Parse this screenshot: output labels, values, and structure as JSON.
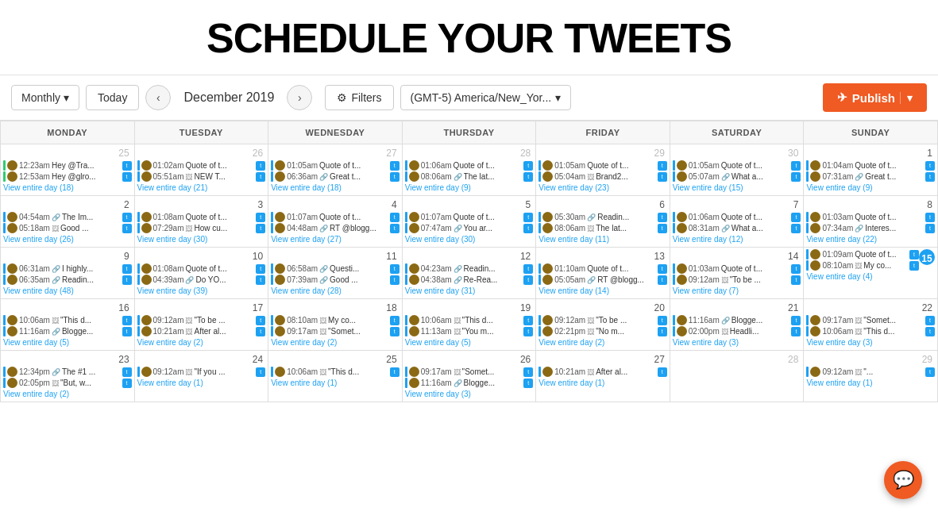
{
  "title": "SCHEDULE YOUR TWEETS",
  "toolbar": {
    "monthly_label": "Monthly",
    "today_label": "Today",
    "prev_label": "‹",
    "next_label": "›",
    "date_label": "December 2019",
    "filters_label": "Filters",
    "timezone_label": "(GMT-5) America/New_Yor...",
    "publish_label": "Publish"
  },
  "calendar": {
    "headers": [
      "MONDAY",
      "TUESDAY",
      "WEDNESDAY",
      "THURSDAY",
      "FRIDAY",
      "SATURDAY",
      "SUNDAY"
    ],
    "weeks": [
      {
        "days": [
          {
            "num": "25",
            "other": true,
            "tweets": [
              {
                "time": "12:23am",
                "icon": "",
                "text": "Hey @Tra...",
                "bar": "green"
              },
              {
                "time": "12:53am",
                "icon": "",
                "text": "Hey @glro...",
                "bar": "green"
              }
            ],
            "view": "View entire day (18)"
          },
          {
            "num": "26",
            "other": true,
            "tweets": [
              {
                "time": "01:02am",
                "icon": "",
                "text": "Quote of t...",
                "bar": "blue"
              },
              {
                "time": "05:51am",
                "icon": "🖼",
                "text": "NEW T...",
                "bar": "blue"
              }
            ],
            "view": "View entire day (21)"
          },
          {
            "num": "27",
            "other": true,
            "tweets": [
              {
                "time": "01:05am",
                "icon": "",
                "text": "Quote of t...",
                "bar": "blue"
              },
              {
                "time": "06:36am",
                "icon": "🔗",
                "text": "Great t...",
                "bar": "blue"
              }
            ],
            "view": "View entire day (18)"
          },
          {
            "num": "28",
            "other": true,
            "tweets": [
              {
                "time": "01:06am",
                "icon": "",
                "text": "Quote of t...",
                "bar": "blue"
              },
              {
                "time": "08:06am",
                "icon": "🔗",
                "text": "The lat...",
                "bar": "blue"
              }
            ],
            "view": "View entire day (9)"
          },
          {
            "num": "29",
            "other": true,
            "tweets": [
              {
                "time": "01:05am",
                "icon": "",
                "text": "Quote of t...",
                "bar": "blue"
              },
              {
                "time": "05:04am",
                "icon": "🖼",
                "text": "Brand2...",
                "bar": "blue"
              }
            ],
            "view": "View entire day (23)"
          },
          {
            "num": "30",
            "other": true,
            "tweets": [
              {
                "time": "01:05am",
                "icon": "",
                "text": "Quote of t...",
                "bar": "blue"
              },
              {
                "time": "05:07am",
                "icon": "🔗",
                "text": "What a...",
                "bar": "blue"
              }
            ],
            "view": "View entire day (15)"
          },
          {
            "num": "1",
            "tweets": [
              {
                "time": "01:04am",
                "icon": "",
                "text": "Quote of t...",
                "bar": "blue"
              },
              {
                "time": "07:31am",
                "icon": "🔗",
                "text": "Great t...",
                "bar": "blue"
              }
            ],
            "view": "View entire day (9)"
          }
        ]
      },
      {
        "days": [
          {
            "num": "2",
            "tweets": [
              {
                "time": "04:54am",
                "icon": "🔗",
                "text": "The Im...",
                "bar": "blue"
              },
              {
                "time": "05:18am",
                "icon": "🖼",
                "text": "Good ...",
                "bar": "blue"
              }
            ],
            "view": "View entire day (26)"
          },
          {
            "num": "3",
            "tweets": [
              {
                "time": "01:08am",
                "icon": "",
                "text": "Quote of t...",
                "bar": "blue"
              },
              {
                "time": "07:29am",
                "icon": "🖼",
                "text": "How cu...",
                "bar": "blue"
              }
            ],
            "view": "View entire day (30)"
          },
          {
            "num": "4",
            "tweets": [
              {
                "time": "01:07am",
                "icon": "",
                "text": "Quote of t...",
                "bar": "blue"
              },
              {
                "time": "04:48am",
                "icon": "🔗",
                "text": "RT @blogg...",
                "bar": "blue"
              }
            ],
            "view": "View entire day (27)"
          },
          {
            "num": "5",
            "tweets": [
              {
                "time": "01:07am",
                "icon": "",
                "text": "Quote of t...",
                "bar": "blue"
              },
              {
                "time": "07:47am",
                "icon": "🔗",
                "text": "You ar...",
                "bar": "blue"
              }
            ],
            "view": "View entire day (30)"
          },
          {
            "num": "6",
            "tweets": [
              {
                "time": "05:30am",
                "icon": "🔗",
                "text": "Readin...",
                "bar": "blue"
              },
              {
                "time": "08:06am",
                "icon": "🖼",
                "text": "The lat...",
                "bar": "blue"
              }
            ],
            "view": "View entire day (11)"
          },
          {
            "num": "7",
            "tweets": [
              {
                "time": "01:06am",
                "icon": "",
                "text": "Quote of t...",
                "bar": "blue"
              },
              {
                "time": "08:31am",
                "icon": "🔗",
                "text": "What a...",
                "bar": "blue"
              }
            ],
            "view": "View entire day (12)"
          },
          {
            "num": "8",
            "tweets": [
              {
                "time": "01:03am",
                "icon": "",
                "text": "Quote of t...",
                "bar": "blue"
              },
              {
                "time": "07:34am",
                "icon": "🔗",
                "text": "Interes...",
                "bar": "blue"
              }
            ],
            "view": "View entire day (22)"
          }
        ]
      },
      {
        "days": [
          {
            "num": "9",
            "tweets": [
              {
                "time": "06:31am",
                "icon": "🔗",
                "text": "I highly...",
                "bar": "blue"
              },
              {
                "time": "06:35am",
                "icon": "🔗",
                "text": "Readin...",
                "bar": "blue"
              }
            ],
            "view": "View entire day (48)"
          },
          {
            "num": "10",
            "tweets": [
              {
                "time": "01:08am",
                "icon": "",
                "text": "Quote of t...",
                "bar": "blue"
              },
              {
                "time": "04:39am",
                "icon": "🔗",
                "text": "Do YO...",
                "bar": "blue"
              }
            ],
            "view": "View entire day (39)"
          },
          {
            "num": "11",
            "tweets": [
              {
                "time": "06:58am",
                "icon": "🔗",
                "text": "Questi...",
                "bar": "blue"
              },
              {
                "time": "07:39am",
                "icon": "🔗",
                "text": "Good ...",
                "bar": "blue"
              }
            ],
            "view": "View entire day (28)"
          },
          {
            "num": "12",
            "tweets": [
              {
                "time": "04:23am",
                "icon": "🔗",
                "text": "Readin...",
                "bar": "blue"
              },
              {
                "time": "04:38am",
                "icon": "🔗",
                "text": "Re-Rea...",
                "bar": "blue"
              }
            ],
            "view": "View entire day (31)"
          },
          {
            "num": "13",
            "tweets": [
              {
                "time": "01:10am",
                "icon": "",
                "text": "Quote of t...",
                "bar": "blue"
              },
              {
                "time": "05:05am",
                "icon": "🔗",
                "text": "RT @blogg...",
                "bar": "blue"
              }
            ],
            "view": "View entire day (14)"
          },
          {
            "num": "14",
            "tweets": [
              {
                "time": "01:03am",
                "icon": "",
                "text": "Quote of t...",
                "bar": "blue"
              },
              {
                "time": "09:12am",
                "icon": "🖼",
                "text": "\"To be ...",
                "bar": "blue"
              }
            ],
            "view": "View entire day (7)"
          },
          {
            "num": "15",
            "today": true,
            "tweets": [
              {
                "time": "01:09am",
                "icon": "",
                "text": "Quote of t...",
                "bar": "blue"
              },
              {
                "time": "08:10am",
                "icon": "🖼",
                "text": "My co...",
                "bar": "blue"
              }
            ],
            "view": "View entire day (4)"
          }
        ]
      },
      {
        "days": [
          {
            "num": "16",
            "tweets": [
              {
                "time": "10:06am",
                "icon": "🖼",
                "text": "\"This d...",
                "bar": "blue"
              },
              {
                "time": "11:16am",
                "icon": "🔗",
                "text": "Blogge...",
                "bar": "blue"
              }
            ],
            "view": "View entire day (5)"
          },
          {
            "num": "17",
            "tweets": [
              {
                "time": "09:12am",
                "icon": "🖼",
                "text": "\"To be ...",
                "bar": "blue"
              },
              {
                "time": "10:21am",
                "icon": "🖼",
                "text": "After al...",
                "bar": "blue"
              }
            ],
            "view": "View entire day (2)"
          },
          {
            "num": "18",
            "tweets": [
              {
                "time": "08:10am",
                "icon": "🖼",
                "text": "My co...",
                "bar": "blue"
              },
              {
                "time": "09:17am",
                "icon": "🖼",
                "text": "\"Somet...",
                "bar": "blue"
              }
            ],
            "view": "View entire day (2)"
          },
          {
            "num": "19",
            "tweets": [
              {
                "time": "10:06am",
                "icon": "🖼",
                "text": "\"This d...",
                "bar": "blue"
              },
              {
                "time": "11:13am",
                "icon": "🖼",
                "text": "\"You m...",
                "bar": "blue"
              }
            ],
            "view": "View entire day (5)"
          },
          {
            "num": "20",
            "tweets": [
              {
                "time": "09:12am",
                "icon": "🖼",
                "text": "\"To be ...",
                "bar": "blue"
              },
              {
                "time": "02:21pm",
                "icon": "🖼",
                "text": "\"No m...",
                "bar": "blue"
              }
            ],
            "view": "View entire day (2)"
          },
          {
            "num": "21",
            "tweets": [
              {
                "time": "11:16am",
                "icon": "🔗",
                "text": "Blogge...",
                "bar": "blue"
              },
              {
                "time": "02:00pm",
                "icon": "🖼",
                "text": "Headli...",
                "bar": "blue"
              }
            ],
            "view": "View entire day (3)"
          },
          {
            "num": "22",
            "tweets": [
              {
                "time": "09:17am",
                "icon": "🖼",
                "text": "\"Somet...",
                "bar": "blue"
              },
              {
                "time": "10:06am",
                "icon": "🖼",
                "text": "\"This d...",
                "bar": "blue"
              }
            ],
            "view": "View entire day (3)"
          }
        ]
      },
      {
        "days": [
          {
            "num": "23",
            "tweets": [
              {
                "time": "12:34pm",
                "icon": "🔗",
                "text": "The #1 ...",
                "bar": "blue"
              },
              {
                "time": "02:05pm",
                "icon": "🖼",
                "text": "\"But, w...",
                "bar": "blue"
              }
            ],
            "view": "View entire day (2)"
          },
          {
            "num": "24",
            "tweets": [
              {
                "time": "09:12am",
                "icon": "🖼",
                "text": "\"If you ...",
                "bar": "blue"
              }
            ],
            "view": "View entire day (1)"
          },
          {
            "num": "25",
            "tweets": [
              {
                "time": "10:06am",
                "icon": "🖼",
                "text": "\"This d...",
                "bar": "blue"
              }
            ],
            "view": "View entire day (1)"
          },
          {
            "num": "26",
            "tweets": [
              {
                "time": "09:17am",
                "icon": "🖼",
                "text": "\"Somet...",
                "bar": "blue"
              },
              {
                "time": "11:16am",
                "icon": "🔗",
                "text": "Blogge...",
                "bar": "blue"
              }
            ],
            "view": "View entire day (3)"
          },
          {
            "num": "27",
            "tweets": [
              {
                "time": "10:21am",
                "icon": "🖼",
                "text": "After al...",
                "bar": "blue"
              }
            ],
            "view": "View entire day (1)"
          },
          {
            "num": "28",
            "other_end": true,
            "tweets": [],
            "view": ""
          },
          {
            "num": "29",
            "other": true,
            "tweets": [
              {
                "time": "09:12am",
                "icon": "🖼",
                "text": "\"...",
                "bar": "blue"
              }
            ],
            "view": "View entire day (1)"
          }
        ]
      }
    ]
  }
}
